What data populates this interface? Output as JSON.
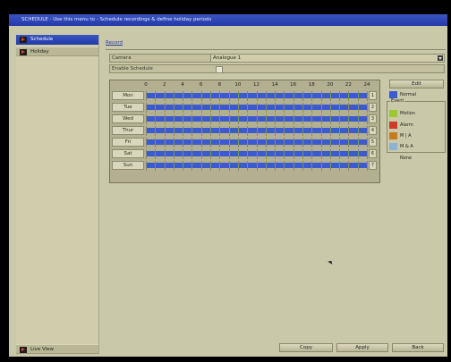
{
  "title_bar": "SCHEDULE - Use this menu to - Schedule recordings & define holiday periods",
  "sidebar": {
    "items": [
      {
        "label": "Schedule"
      },
      {
        "label": "Holiday"
      }
    ],
    "live_view": "Live View"
  },
  "tab": "Record",
  "camera": {
    "label": "Camera",
    "value": "Analogue 1"
  },
  "enable_schedule": {
    "label": "Enable Schedule",
    "checked": false
  },
  "schedule": {
    "hours": [
      "0",
      "2",
      "4",
      "6",
      "8",
      "10",
      "12",
      "14",
      "16",
      "18",
      "20",
      "22",
      "24"
    ],
    "days": [
      {
        "label": "Mon",
        "num": "1"
      },
      {
        "label": "Tue",
        "num": "2"
      },
      {
        "label": "Wed",
        "num": "3"
      },
      {
        "label": "Thur",
        "num": "4"
      },
      {
        "label": "Fri",
        "num": "5"
      },
      {
        "label": "Sat",
        "num": "6"
      },
      {
        "label": "Sun",
        "num": "7"
      }
    ],
    "bar_color": "#3a5ad0"
  },
  "legend": {
    "edit": "Edit",
    "normal": {
      "label": "Normal",
      "color": "#3a5ad0"
    },
    "event_title": "Event",
    "motion": {
      "label": "Motion",
      "color": "#9cc832"
    },
    "alarm": {
      "label": "Alarm",
      "color": "#d23a28"
    },
    "m_or_a": {
      "label": "M | A",
      "color": "#c87a1e"
    },
    "m_and_a": {
      "label": "M & A",
      "color": "#8ab4d0"
    },
    "none": "None"
  },
  "buttons": {
    "copy": "Copy",
    "apply": "Apply",
    "back": "Back"
  }
}
